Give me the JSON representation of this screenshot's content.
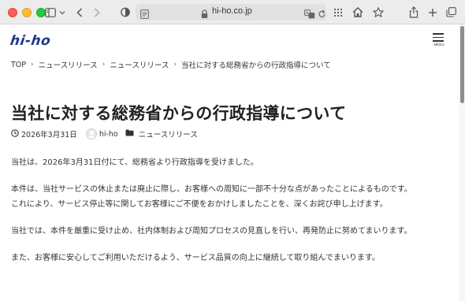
{
  "browser": {
    "url": "hi-ho.co.jp"
  },
  "site": {
    "logo_text": "hi-ho",
    "menu_label": "MENU"
  },
  "breadcrumb": {
    "items": [
      "TOP",
      "ニュースリリース",
      "ニュースリリース",
      "当社に対する総務省からの行政指導について"
    ],
    "separator": "›"
  },
  "article": {
    "title": "当社に対する総務省からの行政指導について",
    "date": "2026年3月31日",
    "author": "hi-ho",
    "category": "ニュースリリース",
    "paragraphs": [
      "当社は、2026年3月31日付にて、総務省より行政指導を受けました。",
      "本件は、当社サービスの休止または廃止に際し、お客様への周知に一部不十分な点があったことによるものです。",
      "これにより、サービス停止等に関してお客様にご不便をおかけしましたことを、深くお詫び申し上げます。",
      "当社では、本件を厳重に受け止め、社内体制および周知プロセスの見直しを行い、再発防止に努めてまいります。",
      "また、お客様に安心してご利用いただけるよう、サービス品質の向上に継続して取り組んでまいります。"
    ]
  },
  "colors": {
    "logo": "#1c3a8a",
    "toolbar": "#ececec",
    "text": "#333333"
  }
}
